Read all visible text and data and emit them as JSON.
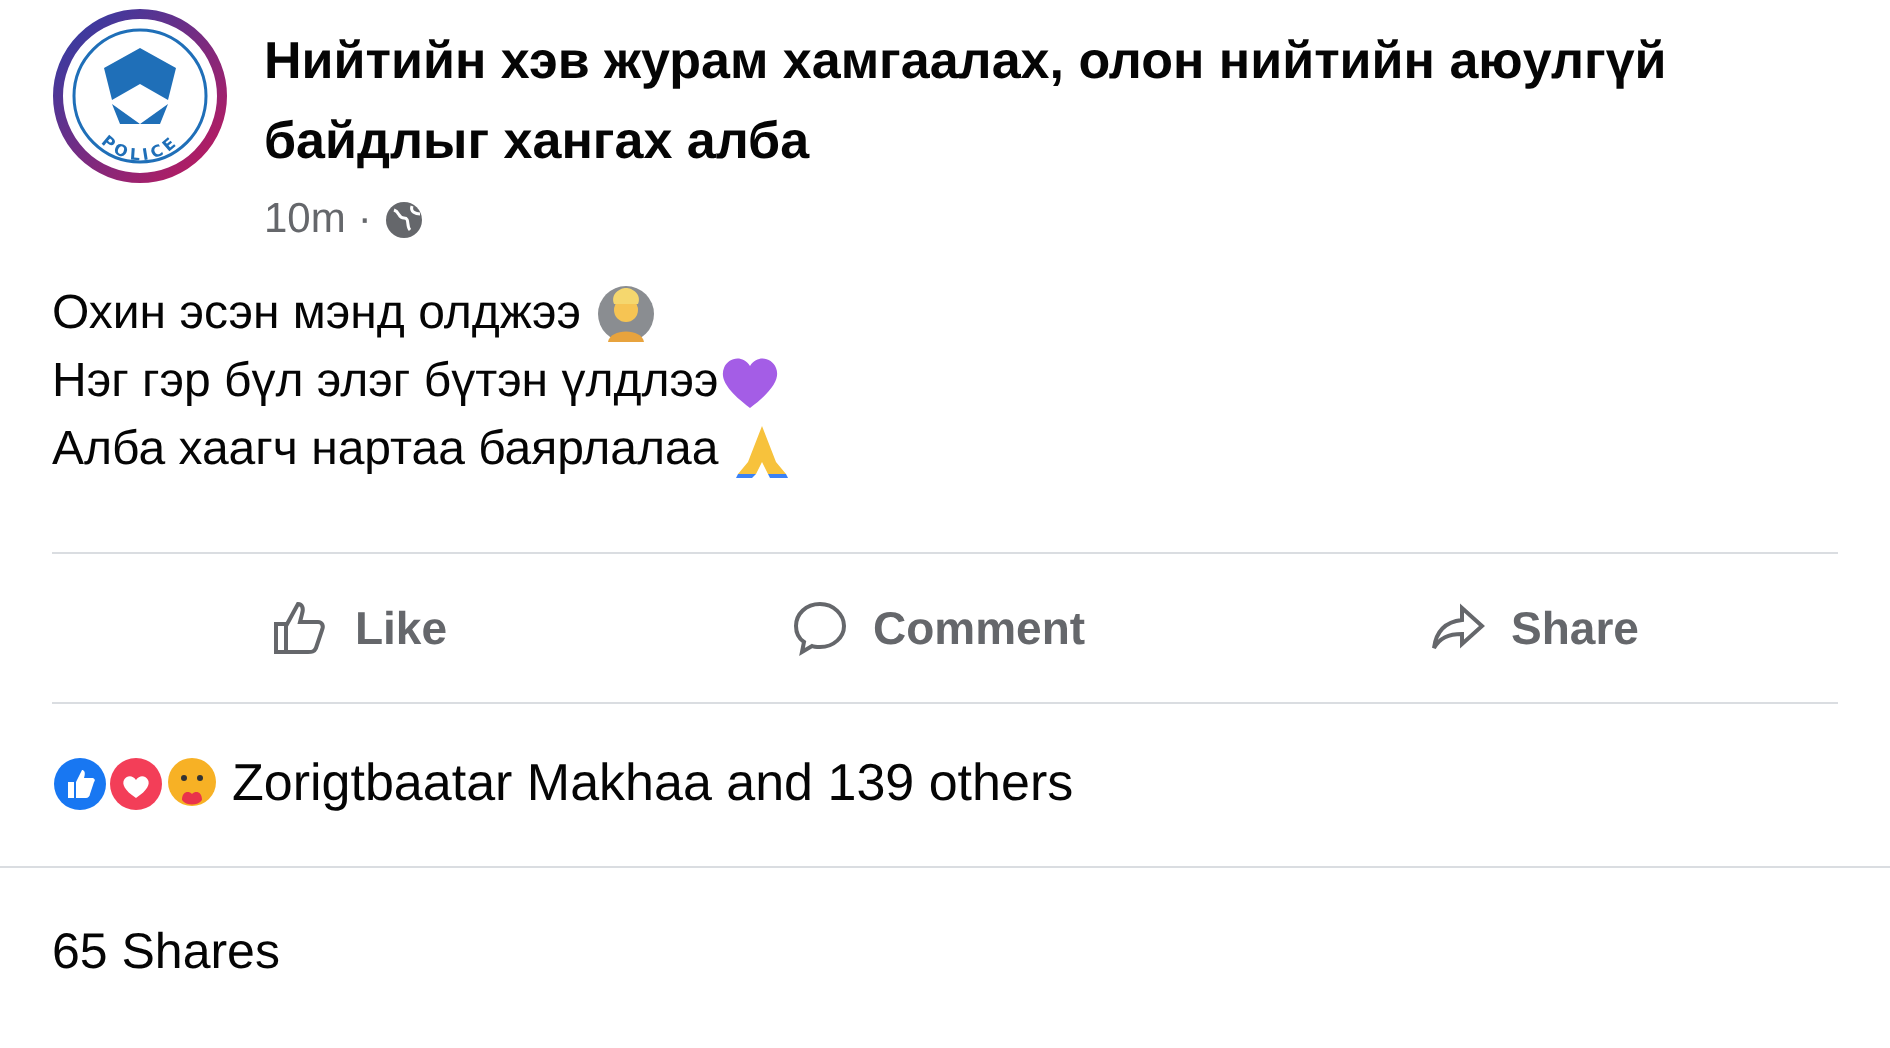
{
  "post": {
    "avatar_label": "POLICE",
    "author": "Нийтийн хэв журам хамгаалах, олон нийтийн аюулгүй байдлыг хангах алба",
    "time": "10m",
    "separator": "·",
    "lines": [
      {
        "text": "Охин эсэн мэнд олджээ",
        "kind": "person"
      },
      {
        "text": "Нэг гэр бүл элэг бүтэн үлдлээ",
        "kind": "heart"
      },
      {
        "text": "Алба хаагч нартаа баярлалаа",
        "kind": "pray"
      }
    ]
  },
  "actions": [
    {
      "label": "Like",
      "kind": "like"
    },
    {
      "label": "Comment",
      "kind": "comment"
    },
    {
      "label": "Share",
      "kind": "share"
    }
  ],
  "reactions": {
    "icons": [
      {
        "kind": "like"
      },
      {
        "kind": "love"
      },
      {
        "kind": "care"
      }
    ],
    "summary": "Zorigtbaatar Makhaa and 139 others"
  },
  "shares": "65 Shares"
}
